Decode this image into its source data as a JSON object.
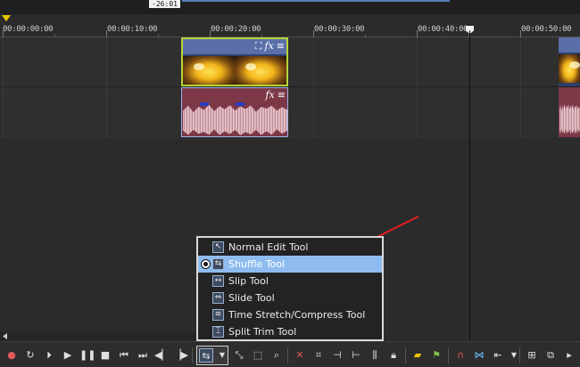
{
  "timeline": {
    "time_tag": "-26:01",
    "ruler_labels": [
      "00:00:00:00",
      "00:00:10:00",
      "00:00:20:00",
      "00:00:30:00",
      "00:00:40:00",
      "00:00:50:00"
    ]
  },
  "clip_icons": {
    "crop": "⛶",
    "fx": "fx",
    "menu": "≡"
  },
  "edit_tool_menu": {
    "items": [
      {
        "label": "Normal Edit Tool",
        "icon": "normal-edit-icon",
        "selected": false
      },
      {
        "label": "Shuffle Tool",
        "icon": "shuffle-icon",
        "selected": true
      },
      {
        "label": "Slip Tool",
        "icon": "slip-icon",
        "selected": false
      },
      {
        "label": "Slide Tool",
        "icon": "slide-icon",
        "selected": false
      },
      {
        "label": "Time Stretch/Compress Tool",
        "icon": "time-stretch-icon",
        "selected": false
      },
      {
        "label": "Split Trim Tool",
        "icon": "split-trim-icon",
        "selected": false
      }
    ]
  },
  "colors": {
    "accent_selected": "#8ebcf0",
    "video_clip_border": "#b8d438",
    "audio_clip": "#7c3846",
    "arrow": "#e02020"
  }
}
